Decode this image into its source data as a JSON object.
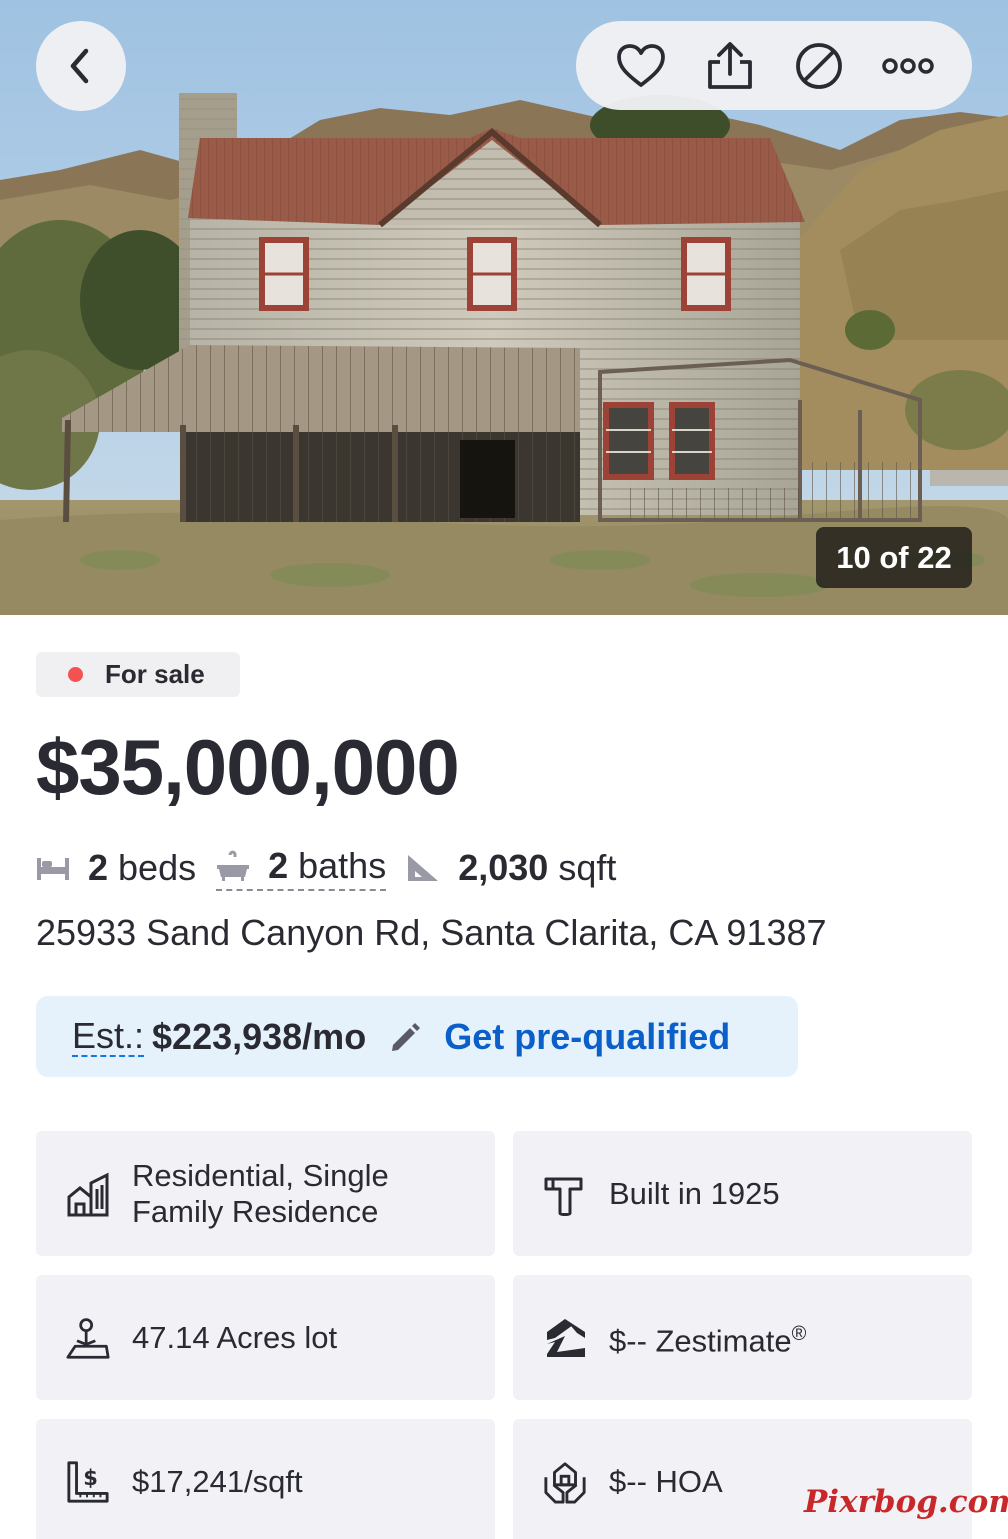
{
  "photo": {
    "counter": "10 of 22"
  },
  "actions": {
    "back_icon": "chevron-left-icon",
    "save_icon": "heart-icon",
    "share_icon": "share-icon",
    "hide_icon": "block-icon",
    "more_icon": "more-icon"
  },
  "listing": {
    "status": "For sale",
    "status_color": "#f65151",
    "price": "$35,000,000",
    "beds_num": "2",
    "beds_label": "beds",
    "baths_num": "2",
    "baths_label": "baths",
    "sqft_num": "2,030",
    "sqft_label": "sqft",
    "address": "25933 Sand Canyon Rd, Santa Clarita, CA 91387"
  },
  "estimate": {
    "label": "Est.:",
    "amount": "$223,938/mo",
    "cta": "Get pre-qualified",
    "cta_color": "#0b5fc9"
  },
  "tiles": {
    "type": "Residential, Single Family Residence",
    "built": "Built in 1925",
    "lot": "47.14 Acres lot",
    "zestimate": "$-- Zestimate",
    "zestimate_mark": "®",
    "price_per_sqft": "$17,241/sqft",
    "hoa": "$-- HOA"
  },
  "watermark": "Pixrbog.com"
}
